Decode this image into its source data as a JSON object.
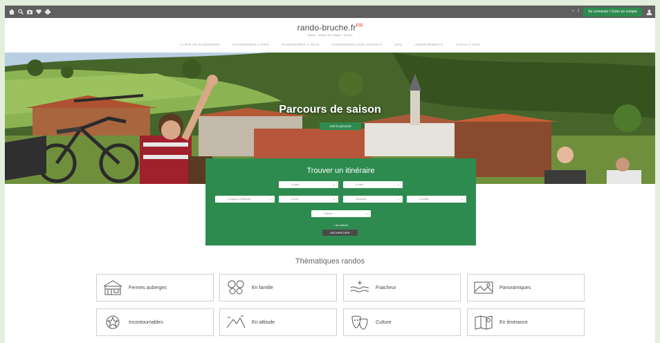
{
  "topbar": {
    "icons": [
      "home-icon",
      "search-icon",
      "camera-icon",
      "heart-icon",
      "print-icon"
    ],
    "right_small": "•",
    "right_text": "f",
    "account_button": "Se connecter / Créer un compte",
    "user_icon": "user-icon"
  },
  "header": {
    "site_title": "rando-bruche.fr",
    "flag": "FR",
    "subtitle": "Alsace · Massif des Vosges · Bruche",
    "nav": [
      "CARTE DE RANDONNÉE",
      "RANDONNÉES À PIED",
      "RANDONNÉES À VÉLO",
      "RANDONNÉES AVEC ENFANTS",
      "GPS",
      "HÉBERGEMENTS",
      "CARTE À VOIR"
    ]
  },
  "hero": {
    "title": "Parcours de saison",
    "button": "Voir le parcours"
  },
  "search": {
    "title": "Trouver un itinéraire",
    "row1": [
      "À pied",
      "À vélo"
    ],
    "row2": [
      "Longueur Difficulté",
      "Durée",
      "Dénivelé",
      "Localité"
    ],
    "row3": [
      "Thème"
    ],
    "link": "+ de critères",
    "submit": "RECHERCHER"
  },
  "thematics": {
    "title": "Thématiques randos",
    "cards": [
      {
        "label": "Fermes auberges",
        "icon": "farm-icon"
      },
      {
        "label": "En famille",
        "icon": "family-icon"
      },
      {
        "label": "Fraicheur",
        "icon": "freshness-icon"
      },
      {
        "label": "Panoramiques",
        "icon": "panorama-icon"
      },
      {
        "label": "Incontournables",
        "icon": "must-see-icon"
      },
      {
        "label": "En altitude",
        "icon": "mountain-icon"
      },
      {
        "label": "Culture",
        "icon": "theatre-masks-icon"
      },
      {
        "label": "En itinérance",
        "icon": "map-route-icon"
      }
    ]
  },
  "colors": {
    "accent_green": "#2e8b50",
    "topbar_gray": "#5f5f5f",
    "page_bg": "#e3eedc"
  }
}
